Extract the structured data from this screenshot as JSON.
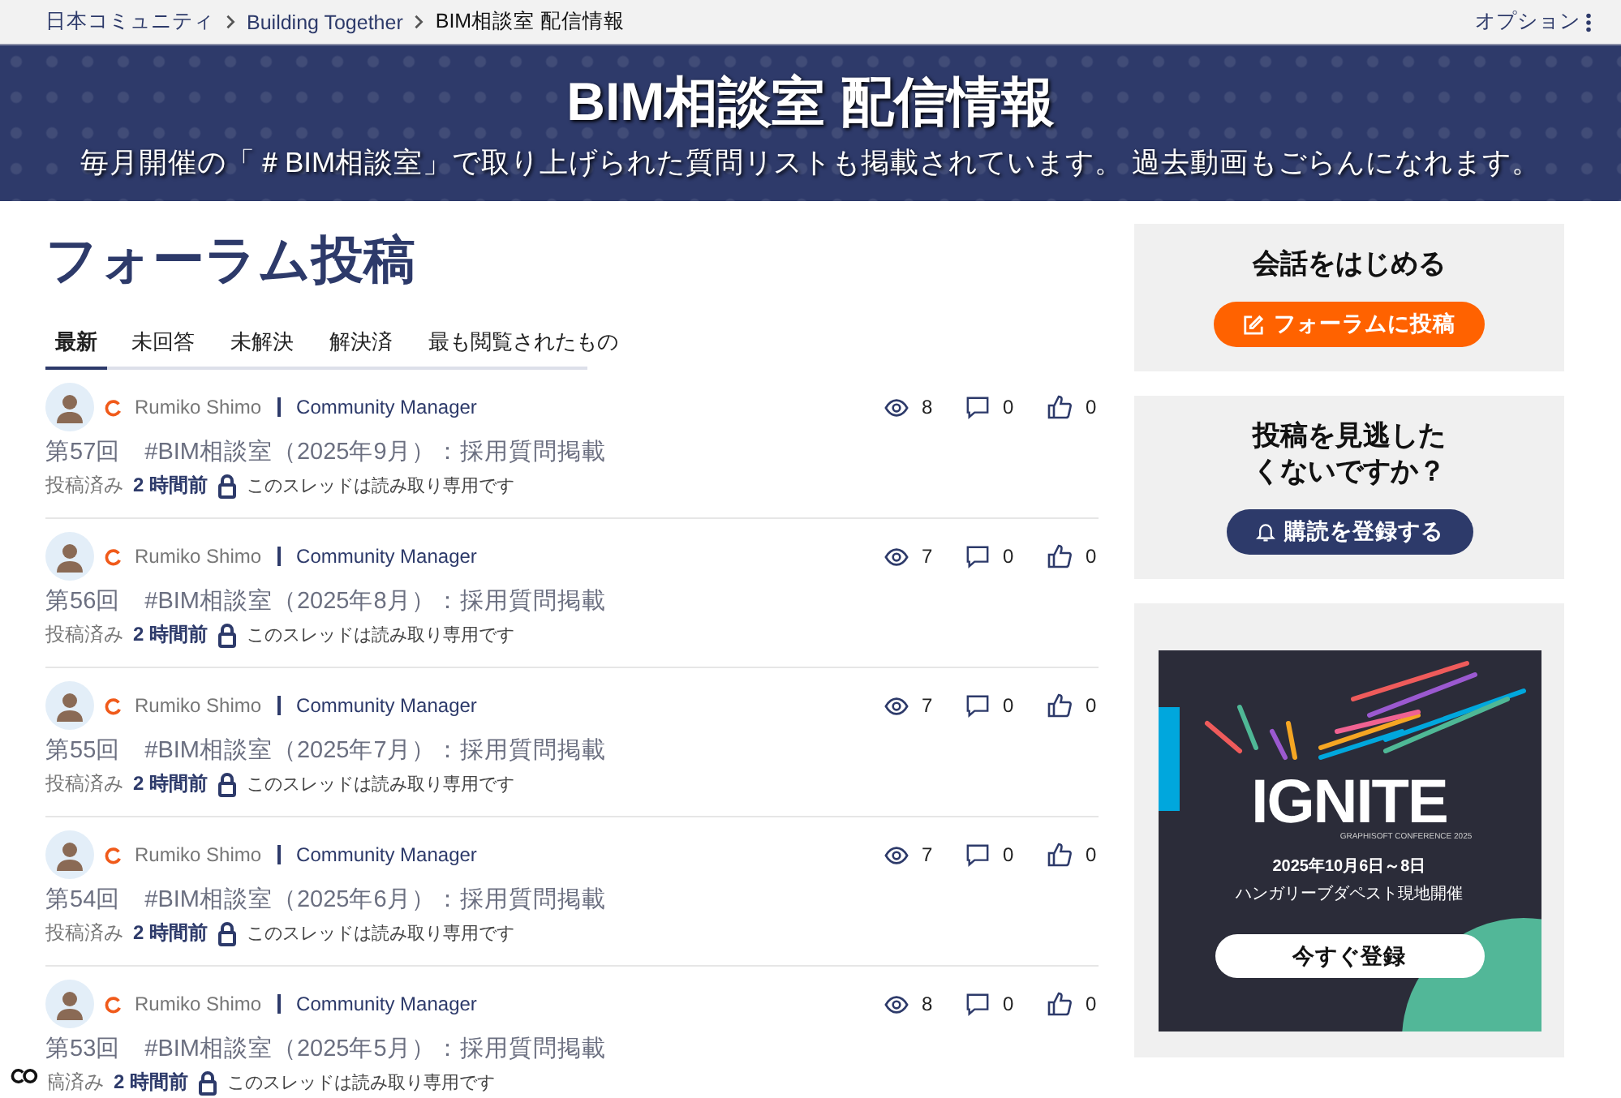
{
  "breadcrumb": {
    "items": [
      "日本コミュニティ",
      "Building Together",
      "BIM相談室 配信情報"
    ],
    "options": "オプション"
  },
  "banner": {
    "title": "BIM相談室 配信情報",
    "subtitle": "毎月開催の「＃BIM相談室」で取り上げられた質問リストも掲載されています。 過去動画もごらんになれます。"
  },
  "forum": {
    "title": "フォーラム投稿",
    "tabs": [
      {
        "label": "最新",
        "selected": true
      },
      {
        "label": "未回答",
        "selected": false
      },
      {
        "label": "未解決",
        "selected": false
      },
      {
        "label": "解決済",
        "selected": false
      },
      {
        "label": "最も閲覧されたもの",
        "selected": false
      }
    ],
    "posts": [
      {
        "author": "Rumiko Shimo",
        "role": "Community Manager",
        "views": "8",
        "replies": "0",
        "likes": "0",
        "title": "第57回　#BIM相談室（2025年9月）：採用質問掲載",
        "status": "投稿済み",
        "time": "2 時間前",
        "note": "このスレッドは読み取り専用です"
      },
      {
        "author": "Rumiko Shimo",
        "role": "Community Manager",
        "views": "7",
        "replies": "0",
        "likes": "0",
        "title": "第56回　#BIM相談室（2025年8月）：採用質問掲載",
        "status": "投稿済み",
        "time": "2 時間前",
        "note": "このスレッドは読み取り専用です"
      },
      {
        "author": "Rumiko Shimo",
        "role": "Community Manager",
        "views": "7",
        "replies": "0",
        "likes": "0",
        "title": "第55回　#BIM相談室（2025年7月）：採用質問掲載",
        "status": "投稿済み",
        "time": "2 時間前",
        "note": "このスレッドは読み取り専用です"
      },
      {
        "author": "Rumiko Shimo",
        "role": "Community Manager",
        "views": "7",
        "replies": "0",
        "likes": "0",
        "title": "第54回　#BIM相談室（2025年6月）：採用質問掲載",
        "status": "投稿済み",
        "time": "2 時間前",
        "note": "このスレッドは読み取り専用です"
      },
      {
        "author": "Rumiko Shimo",
        "role": "Community Manager",
        "views": "8",
        "replies": "0",
        "likes": "0",
        "title": "第53回　#BIM相談室（2025年5月）：採用質問掲載",
        "status": "稿済み",
        "time": "2 時間前",
        "note": "このスレッドは読み取り専用です"
      }
    ]
  },
  "sidebar": {
    "start": {
      "title": "会話をはじめる",
      "button": "フォーラムに投稿"
    },
    "subscribe": {
      "title_lines": [
        "投稿を見逃した",
        "くないですか？"
      ],
      "button": "購読を登録する"
    },
    "ad": {
      "logo": "IGNITE",
      "tagline": "GRAPHISOFT CONFERENCE 2025",
      "dates": "2025年10月6日～8日",
      "place": "ハンガリーブダペスト現地開催",
      "button": "今すぐ登録"
    }
  }
}
